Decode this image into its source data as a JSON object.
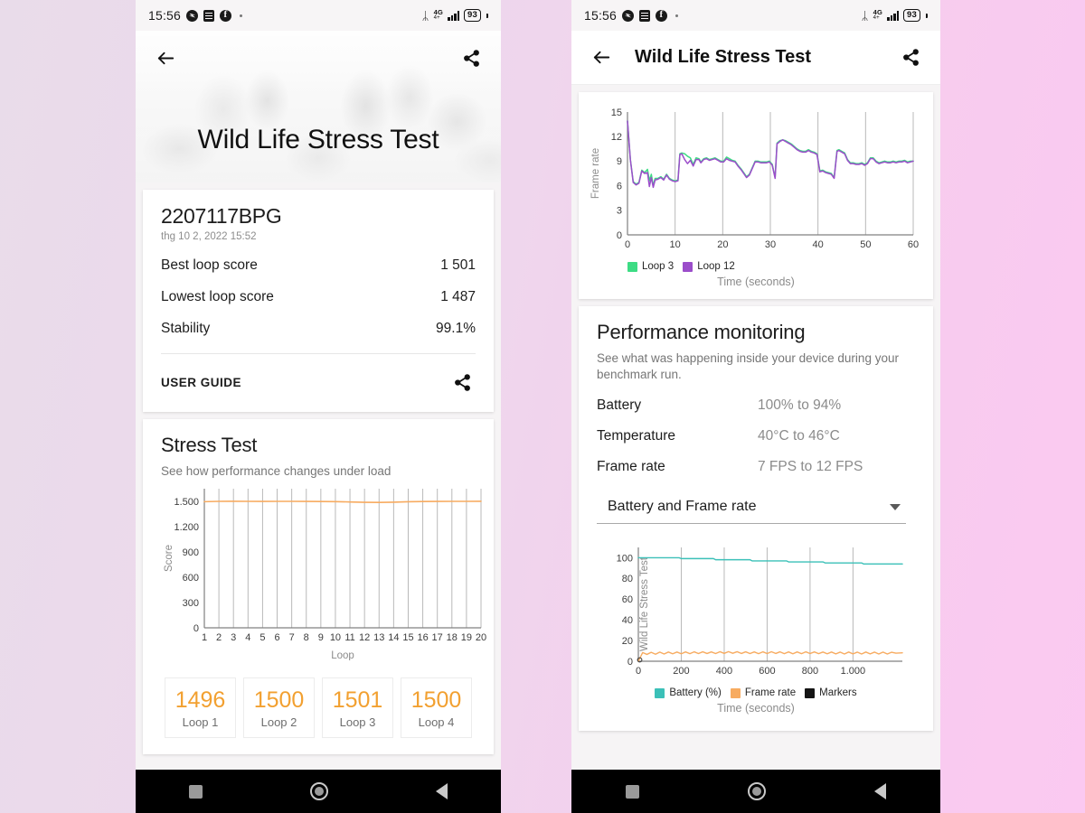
{
  "status_bar": {
    "time": "15:56",
    "icons_left": [
      "messenger-icon",
      "feed-icon",
      "facebook-icon",
      "dot-icon"
    ],
    "bluetooth": "ᛦ",
    "network": "4G",
    "network_sub": "4+",
    "battery": "93"
  },
  "left_phone": {
    "hero": {
      "title": "Wild Life Stress Test",
      "back_icon": "back-arrow-icon",
      "share_icon": "share-icon"
    },
    "result_card": {
      "device": "2207117BPG",
      "date": "thg 10 2, 2022 15:52",
      "rows": [
        {
          "label": "Best loop score",
          "value": "1 501"
        },
        {
          "label": "Lowest loop score",
          "value": "1 487"
        },
        {
          "label": "Stability",
          "value": "99.1%"
        }
      ],
      "user_guide_label": "USER GUIDE",
      "share_icon": "share-icon"
    },
    "stress_card": {
      "title": "Stress Test",
      "subtitle": "See how performance changes under load",
      "loops": [
        {
          "value": "1496",
          "label": "Loop 1"
        },
        {
          "value": "1500",
          "label": "Loop 2"
        },
        {
          "value": "1501",
          "label": "Loop 3"
        },
        {
          "value": "1500",
          "label": "Loop 4"
        }
      ]
    }
  },
  "right_phone": {
    "appbar": {
      "title": "Wild Life Stress Test",
      "back_icon": "back-arrow-icon",
      "share_icon": "share-icon"
    },
    "perf_card": {
      "title": "Performance monitoring",
      "subtitle": "See what was happening inside your device during your benchmark run.",
      "rows": [
        {
          "label": "Battery",
          "value": "100% to 94%"
        },
        {
          "label": "Temperature",
          "value": "40°C to 46°C"
        },
        {
          "label": "Frame rate",
          "value": "7 FPS to 12 FPS"
        }
      ],
      "select_value": "Battery and Frame rate",
      "caret_icon": "chevron-down-icon"
    }
  },
  "nav_bar": {
    "recents": "square-icon",
    "home": "circle-icon",
    "back": "triangle-back-icon"
  },
  "colors": {
    "accent_orange": "#f2a030",
    "line_orange": "#f7ab60",
    "green": "#3ddc84",
    "purple": "#9b4dca",
    "teal": "#3bc0b8",
    "marker_black": "#141414",
    "grid": "#b9b9b9",
    "background": "#f0d4ed"
  },
  "chart_data": [
    {
      "id": "stress-test-chart",
      "type": "line",
      "title": "Stress Test",
      "xlabel": "Loop",
      "ylabel": "Score",
      "ylim": [
        0,
        1650
      ],
      "yticks": [
        0,
        300,
        600,
        900,
        1200,
        1500
      ],
      "ytick_labels": [
        "0",
        "300",
        "600",
        "900",
        "1.200",
        "1.500"
      ],
      "grid": true,
      "categories": [
        1,
        2,
        3,
        4,
        5,
        6,
        7,
        8,
        9,
        10,
        11,
        12,
        13,
        14,
        15,
        16,
        17,
        18,
        19,
        20
      ],
      "xtick_labels": [
        "1",
        "2",
        "3",
        "4",
        "5",
        "6",
        "7",
        "8",
        "9",
        "10",
        "11",
        "12",
        "13",
        "14",
        "15",
        "16",
        "17",
        "18",
        "19",
        "20"
      ],
      "series": [
        {
          "name": "Score",
          "color": "#f7ab60",
          "values": [
            1496,
            1500,
            1501,
            1500,
            1499,
            1500,
            1500,
            1499,
            1498,
            1497,
            1493,
            1489,
            1487,
            1490,
            1495,
            1498,
            1499,
            1500,
            1500,
            1501
          ]
        }
      ]
    },
    {
      "id": "frame-rate-chart",
      "type": "line",
      "xlabel": "Time (seconds)",
      "ylabel": "Frame rate",
      "ylim": [
        0,
        15
      ],
      "yticks": [
        0,
        3,
        6,
        9,
        12,
        15
      ],
      "ytick_labels": [
        "0",
        "3",
        "6",
        "9",
        "12",
        "15"
      ],
      "xlim": [
        0,
        60
      ],
      "xticks": [
        0,
        10,
        20,
        30,
        40,
        50,
        60
      ],
      "xtick_labels": [
        "0",
        "10",
        "20",
        "30",
        "40",
        "50",
        "60"
      ],
      "grid": true,
      "legend_position": "bottom-left",
      "series": [
        {
          "name": "Loop 3",
          "color": "#3ddc84",
          "x": [
            0,
            0.6,
            1.2,
            1.8,
            2.4,
            3,
            3.6,
            4.2,
            4.6,
            5,
            5.4,
            5.8,
            6.4,
            7,
            7.6,
            8.2,
            8.8,
            9.4,
            10,
            10.6,
            11,
            11.4,
            12,
            12.6,
            13.2,
            13.8,
            14.4,
            15,
            15.4,
            16,
            16.6,
            17.2,
            17.8,
            18.4,
            19,
            19.6,
            20.2,
            20.8,
            21.4,
            22,
            22.6,
            23.2,
            23.8,
            24.4,
            25,
            25.6,
            26.2,
            26.8,
            27.4,
            28,
            28.6,
            29.2,
            29.8,
            30.4,
            31,
            31.4,
            32,
            32.6,
            33.2,
            33.8,
            34.4,
            35,
            35.6,
            36.2,
            36.8,
            37.4,
            38,
            38.6,
            39.2,
            39.8,
            40.4,
            41,
            41.6,
            42.2,
            42.8,
            43.4,
            44,
            44.4,
            45,
            45.6,
            46.2,
            46.8,
            47.4,
            48,
            48.6,
            49.2,
            49.8,
            50.4,
            51,
            51.6,
            52.2,
            52.8,
            53.4,
            54,
            54.6,
            55.2,
            55.8,
            56.4,
            57,
            57.6,
            58.2,
            58.8,
            59.4,
            60
          ],
          "y": [
            13.9,
            9.2,
            6.5,
            6.2,
            6.4,
            7.9,
            7.6,
            8,
            6.6,
            7.4,
            6,
            6.9,
            6.9,
            7.1,
            6.8,
            7.4,
            6.9,
            6.7,
            6.6,
            6.7,
            9.9,
            10,
            9.9,
            9.6,
            9.4,
            8.6,
            9.4,
            9.3,
            8.9,
            9.3,
            9.4,
            9.2,
            9.3,
            9.4,
            9.2,
            9,
            9,
            9.5,
            9.3,
            9.1,
            9,
            8.5,
            8.1,
            7.6,
            7.1,
            7.4,
            8.2,
            9,
            9,
            8.9,
            8.9,
            8.9,
            9,
            8.6,
            7,
            11.2,
            11.5,
            11.6,
            11.5,
            11.3,
            11.1,
            10.8,
            10.5,
            10.3,
            10.2,
            10.2,
            10.4,
            10.2,
            10.1,
            9.9,
            7.8,
            7.9,
            7.7,
            7.6,
            7.5,
            7,
            10.3,
            10.4,
            10.2,
            10,
            9.2,
            8.8,
            8.8,
            8.7,
            8.7,
            8.8,
            8.6,
            8.8,
            9.4,
            9.4,
            9,
            8.8,
            8.9,
            9,
            8.9,
            8.9,
            9,
            8.9,
            9,
            9,
            9.1,
            8.9,
            9,
            9
          ]
        },
        {
          "name": "Loop 12",
          "color": "#9b4dca",
          "x": [
            0,
            0.6,
            1.2,
            1.8,
            2.4,
            3,
            3.6,
            4.2,
            4.6,
            5,
            5.4,
            5.8,
            6.4,
            7,
            7.6,
            8.2,
            8.8,
            9.4,
            10,
            10.6,
            11,
            11.4,
            12,
            12.6,
            13.2,
            13.8,
            14.4,
            15,
            15.4,
            16,
            16.6,
            17.2,
            17.8,
            18.4,
            19,
            19.6,
            20.2,
            20.8,
            21.4,
            22,
            22.6,
            23.2,
            23.8,
            24.4,
            25,
            25.6,
            26.2,
            26.8,
            27.4,
            28,
            28.6,
            29.2,
            29.8,
            30.4,
            31,
            31.4,
            32,
            32.6,
            33.2,
            33.8,
            34.4,
            35,
            35.6,
            36.2,
            36.8,
            37.4,
            38,
            38.6,
            39.2,
            39.8,
            40.4,
            41,
            41.6,
            42.2,
            42.8,
            43.4,
            44,
            44.4,
            45,
            45.6,
            46.2,
            46.8,
            47.4,
            48,
            48.6,
            49.2,
            49.8,
            50.4,
            51,
            51.6,
            52.2,
            52.8,
            53.4,
            54,
            54.6,
            55.2,
            55.8,
            56.4,
            57,
            57.6,
            58.2,
            58.8,
            59.4,
            60
          ],
          "y": [
            13.9,
            9.2,
            6.4,
            6.1,
            6.3,
            7.8,
            7.5,
            7.6,
            5.9,
            7.0,
            5.8,
            6.7,
            6.8,
            7.0,
            6.7,
            7.3,
            6.8,
            6.6,
            6.5,
            6.6,
            9.8,
            9.9,
            9.2,
            8.7,
            9.1,
            8.4,
            9.2,
            9.2,
            8.8,
            9.2,
            9.3,
            9.1,
            9.2,
            9.3,
            9.1,
            8.9,
            8.9,
            9.3,
            9.1,
            9.0,
            8.9,
            8.4,
            8.0,
            7.5,
            7.0,
            7.3,
            8.1,
            8.9,
            8.9,
            8.8,
            8.8,
            8.8,
            8.9,
            8.5,
            6.9,
            11.1,
            11.4,
            11.6,
            11.4,
            11.2,
            11.0,
            10.7,
            10.4,
            10.2,
            10.1,
            10.1,
            10.3,
            10.1,
            10.0,
            9.8,
            7.7,
            7.8,
            7.6,
            7.5,
            7.4,
            6.9,
            10.2,
            10.3,
            10.1,
            9.9,
            9.1,
            8.7,
            8.7,
            8.6,
            8.6,
            8.7,
            8.5,
            8.7,
            9.3,
            9.3,
            8.9,
            8.7,
            8.8,
            8.9,
            8.8,
            8.8,
            8.9,
            8.8,
            8.9,
            8.9,
            9.0,
            8.8,
            8.9,
            9.0
          ]
        }
      ]
    },
    {
      "id": "battery-frame-rate-chart",
      "type": "line",
      "xlabel": "Time (seconds)",
      "ylabel": "Wild Life Stress Test",
      "ylim": [
        0,
        110
      ],
      "yticks": [
        0,
        20,
        40,
        60,
        80,
        100
      ],
      "ytick_labels": [
        "0",
        "20",
        "40",
        "60",
        "80",
        "100"
      ],
      "xlim": [
        0,
        1230
      ],
      "xticks": [
        0,
        200,
        400,
        600,
        800,
        1000
      ],
      "xtick_labels": [
        "0",
        "200",
        "400",
        "600",
        "800",
        "1.000"
      ],
      "grid": true,
      "legend_position": "bottom-left",
      "series": [
        {
          "name": "Battery (%)",
          "color": "#3bc0b8",
          "x": [
            0,
            60,
            130,
            190,
            200,
            260,
            330,
            350,
            360,
            430,
            500,
            520,
            530,
            600,
            670,
            690,
            700,
            770,
            840,
            860,
            870,
            940,
            1010,
            1040,
            1050,
            1120,
            1190,
            1230
          ],
          "y": [
            100,
            100,
            100,
            100,
            99.2,
            99.2,
            99.2,
            99.2,
            98.1,
            98.1,
            98.1,
            98.1,
            97.0,
            97.0,
            97.0,
            97.0,
            96.0,
            96.0,
            96.0,
            96.0,
            95.0,
            95.0,
            95.0,
            95.0,
            94.0,
            94.0,
            94.0,
            94.0
          ]
        },
        {
          "name": "Frame rate",
          "color": "#f7ab60",
          "x": [
            0,
            20,
            40,
            60,
            80,
            100,
            120,
            140,
            160,
            180,
            200,
            220,
            240,
            260,
            280,
            300,
            320,
            340,
            360,
            380,
            400,
            420,
            440,
            460,
            480,
            500,
            520,
            540,
            560,
            580,
            600,
            620,
            640,
            660,
            680,
            700,
            720,
            740,
            760,
            780,
            800,
            820,
            840,
            860,
            880,
            900,
            920,
            940,
            960,
            980,
            1000,
            1020,
            1040,
            1060,
            1080,
            1100,
            1120,
            1140,
            1160,
            1180,
            1200,
            1230
          ],
          "y": [
            0,
            8.4,
            6.6,
            8.6,
            6.8,
            8.8,
            7.0,
            8.9,
            7.2,
            8.9,
            7.2,
            9.0,
            7.3,
            9.1,
            7.4,
            9.1,
            7.5,
            9.0,
            7.4,
            9.2,
            7.6,
            9.3,
            7.7,
            9.2,
            7.5,
            9.1,
            7.4,
            9.0,
            7.3,
            9.1,
            7.4,
            9.2,
            7.5,
            9.1,
            7.3,
            9.0,
            7.2,
            9.0,
            7.3,
            9.1,
            7.4,
            9.0,
            7.3,
            8.9,
            7.2,
            8.9,
            7.1,
            8.8,
            7.0,
            8.9,
            7.1,
            8.8,
            7.0,
            8.9,
            7.1,
            8.8,
            7.0,
            8.8,
            7.0,
            8.7,
            7.8,
            8.1
          ]
        },
        {
          "name": "Markers",
          "color": "#141414",
          "x": [],
          "y": []
        }
      ]
    }
  ]
}
